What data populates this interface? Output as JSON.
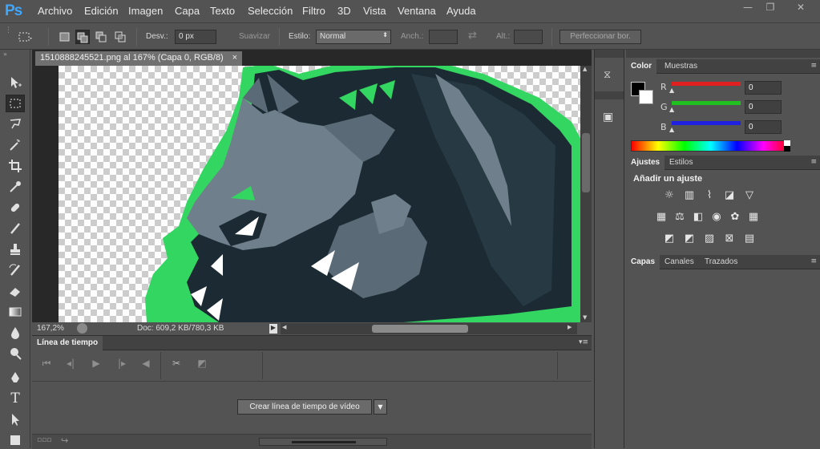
{
  "app": {
    "logo": "Ps"
  },
  "menu": [
    "Archivo",
    "Edición",
    "Imagen",
    "Capa",
    "Texto",
    "Selección",
    "Filtro",
    "3D",
    "Vista",
    "Ventana",
    "Ayuda"
  ],
  "window_controls": {
    "minimize": "—",
    "restore": "❐",
    "close": "✕"
  },
  "options": {
    "feather_label": "Desv.:",
    "feather_value": "0 px",
    "antialias_label": "Suavizar",
    "style_label": "Estilo:",
    "style_value": "Normal",
    "width_label": "Anch.:",
    "height_label": "Alt.:",
    "refine_edge": "Perfeccionar bor."
  },
  "document": {
    "tab_title": "1510888245521.png al 167% (Capa 0, RGB/8)",
    "tab_close": "×",
    "zoom": "167,2%",
    "doc_info": "Doc: 609,2 KB/780,3 KB"
  },
  "tools": [
    "move-icon",
    "marquee-icon",
    "lasso-icon",
    "magic-wand-icon",
    "crop-icon",
    "eyedropper-icon",
    "healing-icon",
    "brush-icon",
    "stamp-icon",
    "history-brush-icon",
    "eraser-icon",
    "gradient-icon",
    "blur-icon",
    "dodge-icon",
    "pen-icon",
    "type-icon",
    "path-select-icon",
    "shape-icon"
  ],
  "timeline": {
    "tab": "Línea de tiempo",
    "create_button": "Crear línea de tiempo de vídeo"
  },
  "color_panel": {
    "tabs": [
      "Color",
      "Muestras"
    ],
    "r_label": "R",
    "g_label": "G",
    "b_label": "B",
    "r_value": "0",
    "g_value": "0",
    "b_value": "0",
    "colors": {
      "r": "#e02020",
      "g": "#20c020",
      "b": "#2020e0"
    }
  },
  "adjustments_panel": {
    "tabs": [
      "Ajustes",
      "Estilos"
    ],
    "heading": "Añadir un ajuste"
  },
  "layers_panel": {
    "tabs": [
      "Capas",
      "Canales",
      "Trazados"
    ]
  }
}
